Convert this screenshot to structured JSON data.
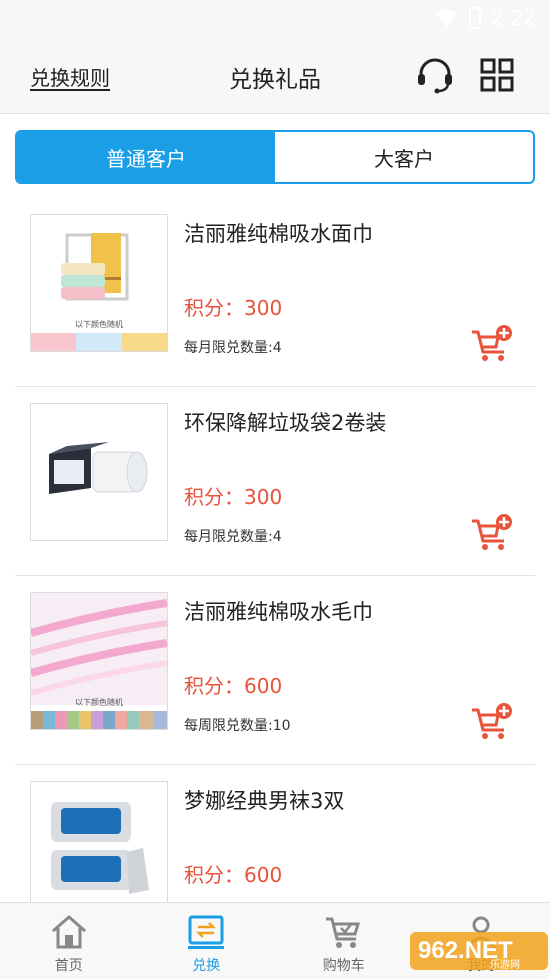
{
  "status_bar": {
    "time": "2:22"
  },
  "header": {
    "rules_label": "兑换规则",
    "title": "兑换礼品",
    "service_icon": "headset-icon",
    "menu_icon": "grid-icon"
  },
  "tabs": [
    {
      "label": "普通客户",
      "active": true
    },
    {
      "label": "大客户",
      "active": false
    }
  ],
  "products": [
    {
      "name": "洁丽雅纯棉吸水面巾",
      "points": "积分：300",
      "limit": "每月限兑数量:4",
      "thumb_caption": "以下颜色随机"
    },
    {
      "name": "环保降解垃圾袋2卷装",
      "points": "积分：300",
      "limit": "每月限兑数量:4",
      "thumb_caption": ""
    },
    {
      "name": "洁丽雅纯棉吸水毛巾",
      "points": "积分：600",
      "limit": "每周限兑数量:10",
      "thumb_caption": "以下颜色随机"
    },
    {
      "name": "梦娜经典男袜3双",
      "points": "积分：600",
      "limit": "",
      "thumb_caption": ""
    }
  ],
  "bottom_nav": [
    {
      "label": "首页",
      "icon": "home-icon",
      "active": false
    },
    {
      "label": "兑换",
      "icon": "exchange-icon",
      "active": true
    },
    {
      "label": "购物车",
      "icon": "shopping-cart-icon",
      "active": false
    },
    {
      "label": "我的",
      "icon": "user-icon",
      "active": false
    }
  ],
  "watermark": {
    "text": "962.NET",
    "subtext": "乐游网"
  },
  "colors": {
    "accent": "#1a9ee6",
    "price": "#e8533b",
    "cart": "#e8533b"
  }
}
